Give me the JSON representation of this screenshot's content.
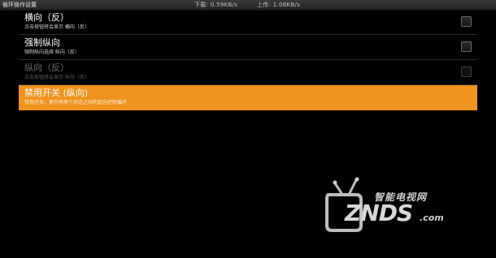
{
  "titlebar": {
    "title": "循环操作设置",
    "download": "下载: 0.59KB/s",
    "upload": "上传: 1.06KB/s"
  },
  "list": {
    "items": [
      {
        "label": "横向（反）",
        "summary": "点击按钮将会显示 横向（反）",
        "state": "normal",
        "checked": false
      },
      {
        "label": "强制纵向",
        "summary": "强制纵向选择 纵向（反）",
        "state": "normal",
        "checked": false
      },
      {
        "label": "纵向（反）",
        "summary": "点击按钮将会显示 纵向（反）",
        "state": "disabled",
        "checked": false
      },
      {
        "label": "禁用开关 (纵向)",
        "summary": "禁用开关，使只有两个状态之间的定向控制循环",
        "state": "selected"
      }
    ]
  },
  "watermark": {
    "cn": "智能电视网",
    "en": "ZNDS",
    "suffix": ".com"
  },
  "colors": {
    "background": "#000000",
    "accent": "#f0931f",
    "divider": "#2b2b2b"
  }
}
